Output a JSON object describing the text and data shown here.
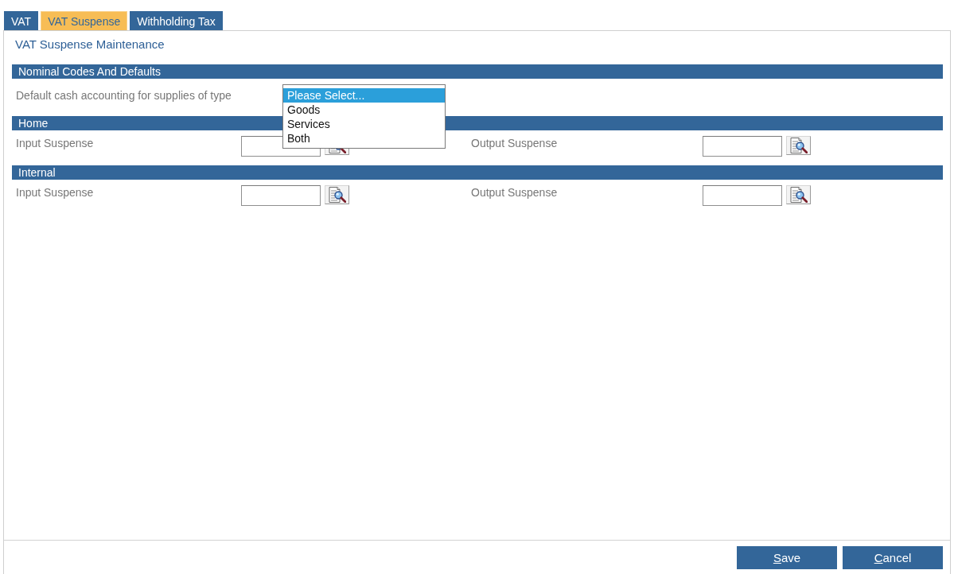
{
  "tabs": [
    {
      "label": "VAT",
      "selected": false
    },
    {
      "label": "VAT Suspense",
      "selected": true
    },
    {
      "label": "Withholding Tax",
      "selected": false
    }
  ],
  "title": "VAT Suspense Maintenance",
  "sections": [
    {
      "title": "Nominal Codes And Defaults",
      "fields": [
        {
          "kind": "select",
          "label": "Default cash accounting for supplies of type",
          "expanded": true,
          "options": [
            {
              "label": "Please Select...",
              "selected": true
            },
            {
              "label": "Goods",
              "selected": false
            },
            {
              "label": "Services",
              "selected": false
            },
            {
              "label": "Both",
              "selected": false
            }
          ]
        }
      ]
    },
    {
      "title": "Home",
      "fields": [
        {
          "kind": "lookup",
          "label": "Input Suspense"
        },
        {
          "kind": "lookup",
          "label": "Output Suspense"
        }
      ]
    },
    {
      "title": "Internal",
      "fields": [
        {
          "kind": "lookup",
          "label": "Input Suspense"
        },
        {
          "kind": "lookup",
          "label": "Output Suspense"
        }
      ]
    }
  ],
  "buttons": [
    {
      "label": "Save",
      "underline_first": true
    },
    {
      "label": "Cancel",
      "underline_first": true
    }
  ]
}
